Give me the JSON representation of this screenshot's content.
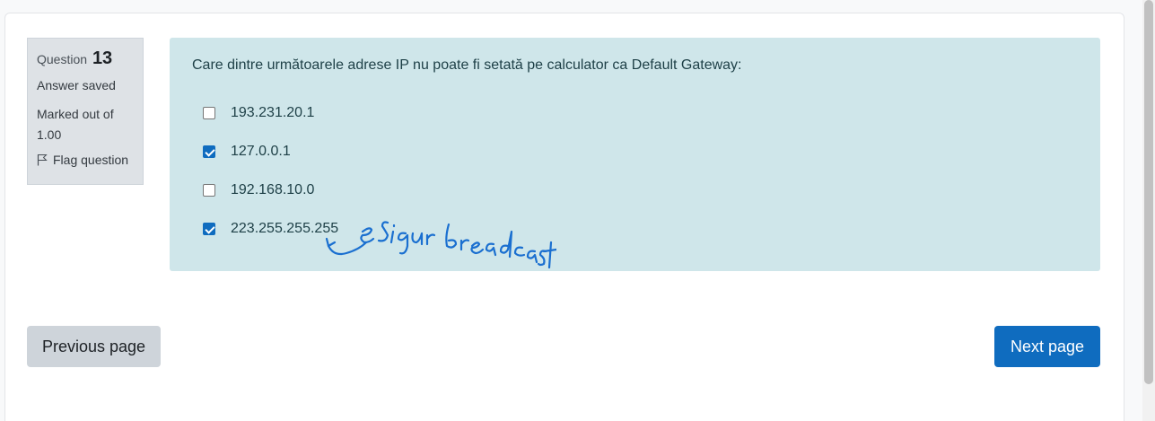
{
  "question": {
    "label": "Question",
    "number": "13",
    "state": "Answer saved",
    "grade": "Marked out of 1.00",
    "flag_label": "Flag question"
  },
  "formulation": {
    "text": "Care dintre următoarele adrese IP nu poate fi setată pe calculator ca Default Gateway:",
    "answers": [
      {
        "label": "193.231.20.1",
        "checked": false
      },
      {
        "label": "127.0.0.1",
        "checked": true
      },
      {
        "label": "192.168.10.0",
        "checked": false
      },
      {
        "label": "223.255.255.255",
        "checked": true
      }
    ],
    "annotation": "e sigur broadcast"
  },
  "nav": {
    "prev_label": "Previous page",
    "next_label": "Next page"
  },
  "colors": {
    "formulation_bg": "#cfe6ea",
    "info_bg": "#dee2e6",
    "primary": "#0f6cbf",
    "secondary": "#ced4da",
    "handwriting": "#1a6fd0"
  }
}
